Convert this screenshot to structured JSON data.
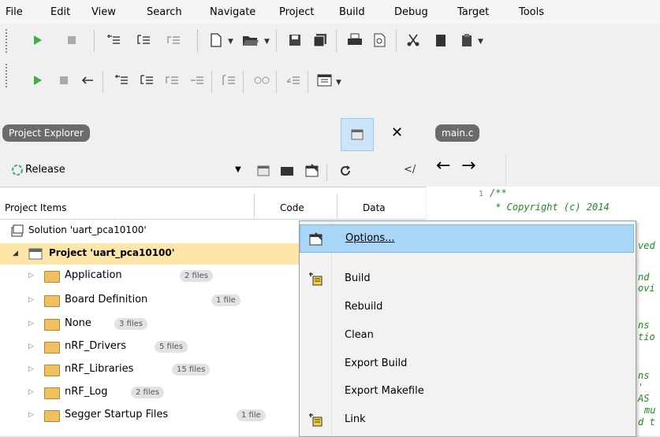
{
  "menubar": {
    "items": [
      "File",
      "Edit",
      "View",
      "Search",
      "Navigate",
      "Project",
      "Build",
      "Debug",
      "Target",
      "Tools"
    ]
  },
  "toolbar1": {
    "icons": [
      "play-icon",
      "stop-icon",
      "step-into-icon",
      "step-over-icon",
      "step-out-icon",
      "new-file-icon",
      "open-icon",
      "save-icon",
      "save-all-icon",
      "print-icon",
      "print-preview-icon",
      "cut-icon",
      "copy-icon",
      "paste-icon"
    ]
  },
  "toolbar2": {
    "icons": [
      "play-icon",
      "stop-icon",
      "back-arrow-icon",
      "step-into-icon",
      "step-over-icon",
      "step-out-icon",
      "run-to-cursor-icon",
      "break-icon",
      "watch-icon",
      "insert-icon",
      "memory-icon"
    ]
  },
  "explorer": {
    "tab_label": "Project Explorer",
    "config_value": "Release",
    "columns": {
      "items": "Project Items",
      "code": "Code",
      "data": "Data"
    },
    "solution": "Solution 'uart_pca10100'",
    "project": "Project 'uart_pca10100'",
    "folders": [
      {
        "name": "Application",
        "count": "2 files"
      },
      {
        "name": "Board Definition",
        "count": "1 file"
      },
      {
        "name": "None",
        "count": "3 files"
      },
      {
        "name": "nRF_Drivers",
        "count": "5 files"
      },
      {
        "name": "nRF_Libraries",
        "count": "15 files"
      },
      {
        "name": "nRF_Log",
        "count": "2 files"
      },
      {
        "name": "Segger Startup Files",
        "count": "1 file"
      }
    ]
  },
  "editor": {
    "tab_label": "main.c",
    "line_number": "1",
    "code_lines": [
      "/**",
      " * Copyright (c) 2014"
    ],
    "fragments": [
      "ved",
      "nd",
      "ovi",
      "ns",
      "tio",
      "ns",
      "' AS",
      "mu",
      "d t"
    ]
  },
  "context_menu": {
    "items": [
      {
        "label": "Options...",
        "icon": "properties-icon",
        "highlighted": true
      },
      {
        "label": "Build",
        "icon": "build-icon"
      },
      {
        "label": "Rebuild"
      },
      {
        "label": "Clean"
      },
      {
        "label": "Export Build"
      },
      {
        "label": "Export Makefile"
      },
      {
        "label": "Link",
        "icon": "link-icon"
      }
    ]
  },
  "colors": {
    "highlight": "#a9d5f7",
    "project_row": "#fde6a8",
    "play": "#3cb043",
    "folder": "#f0c060",
    "comment": "#228b22"
  }
}
